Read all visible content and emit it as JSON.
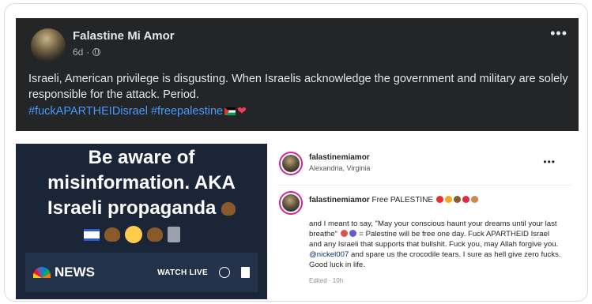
{
  "post": {
    "author": "Falastine Mi Amor",
    "time": "6d",
    "more": "•••",
    "text": "Israeli, American privilege is disgusting. When Israelis acknowledge the government and military are solely responsible for the attack. Period.",
    "hashtags": "#fuckAPARTHEIDisrael #freepalestine"
  },
  "news_image": {
    "text_line1": "Be aware of",
    "text_line2": "misinformation. AKA",
    "text_line3": "Israeli propaganda",
    "brand": "NEWS",
    "watch_live": "WATCH LIVE"
  },
  "instagram": {
    "username": "falastinemiamor",
    "location": "Alexandria, Virginia",
    "more": "•••",
    "caption_user": "falastinemiamor",
    "caption_start": "Free PALESTINE",
    "body_1": "and I meant to say, \"May your conscious haunt your dreams until your last breathe\"",
    "body_2": "= Palestine will be free one day. Fuck APARTHEID Israel and any Israeli that supports that bullshit. Fuck you, may Allah forgive you.",
    "mention": "@nickel007",
    "body_3": "and spare us the crocodile tears. I sure as hell give zero fucks. Good luck in life.",
    "edited": "Edited · 10h"
  },
  "colors": {
    "fb_bg": "#242526",
    "hashtag": "#4599ff",
    "news_bg": "#1b2538"
  }
}
